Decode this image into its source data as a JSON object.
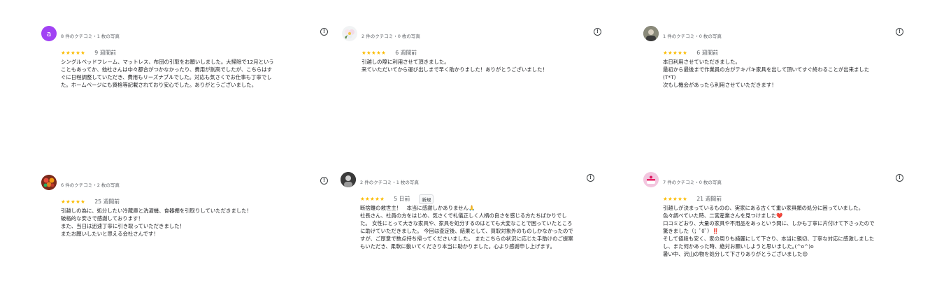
{
  "reviews": [
    {
      "avatar_letter": "a",
      "avatar_color": "#a142f4",
      "meta": "8 件のクチコミ・1 枚の写真",
      "stars": "★★★★★",
      "ago": "9 週間前",
      "lines": [
        "シングルベッドフレーム、マットレス、布団の引取をお願いしました。大掃除で12月という",
        "こともあってか、他社さんは中々都合がつかなかったり、費用が割高でしたが、こちらはす",
        "ぐに日程調整していただき、費用もリーズナブルでした。対応も気さくでお仕事も丁寧でし",
        "た。ホームページにも資格等記載されており安心でした。ありがとうございました。"
      ]
    },
    {
      "meta": "2 件のクチコミ・0 枚の写真",
      "stars": "★★★★★",
      "ago": "6 週間前",
      "lines": [
        "引越しの際に利用させて頂きました。",
        "来ていただいてから運び出しまで早く助かりました！ありがとうございました！"
      ]
    },
    {
      "meta": "1 件のクチコミ・0 枚の写真",
      "stars": "★★★★★",
      "ago": "6 週間前",
      "lines": [
        "本日利用させていただきました。",
        "最初から最後まで作業員の方がテキパキ家具を出して頂いてすぐ終わることが出来ました",
        "(T*T)",
        "次もし機会があったら利用させていただきます！"
      ]
    },
    {
      "meta": "6 件のクチコミ・2 枚の写真",
      "stars": "★★★★★",
      "ago": "25 週間前",
      "lines": [
        "引越しの為に、処分したい冷蔵庫と洗濯機、食器棚を引取りしていただきました！",
        "破格的な安さで感謝しております！",
        "また、当日は迅速丁寧に引き取っていただきました！",
        "またお願いしたいと思える会社さんです！"
      ]
    },
    {
      "meta": "2 件のクチコミ・1 枚の写真",
      "stars": "★★★★★",
      "ago": "5 日前",
      "badge": "新規",
      "lines": [
        "断捨離の救世主！　本当に感謝しかありません🙏",
        "社長さん、社員の方をはじめ、気さくで礼儀正しく人柄の良さを感じる方たちばかりでし",
        "た。 女性にとって大きな家具や、家具を処分するのはとても大変なことで困っていたところ",
        "に助けていただきました。 今回は査定後、結果として、買取対象外のものしかなかったので",
        "すが、ご厚意で数点持ち帰ってくださいました。 またこちらの状況に応じた手助けのご提案",
        "もいただき、柔軟に動いてくださり本当に助かりました。心より感謝申し上げます。"
      ]
    },
    {
      "meta": "7 件のクチコミ・0 枚の写真",
      "stars": "★★★★★",
      "ago": "21 週間前",
      "lines": [
        "引越しが決まっているものの、実家にある古くて重い家具類の処分に困っていました。",
        "色々調べていた時、二宮産業さんを見つけました❤️",
        "口コミどおり、大量の家具や不用品をあっという間に、しかも丁寧に片付けて下さったので",
        "驚きました（；ﾟ0ﾟ）‼️",
        "そして値段も安く、家の周りも綺麗にして下さり、本当に親切、丁寧な対応に感激しました",
        "し、また何かあった時、絶対お願いしようと思いました｡(^o^)o",
        "暑い中、沢山の物を処分して下さりありがとうございました😊"
      ]
    }
  ]
}
